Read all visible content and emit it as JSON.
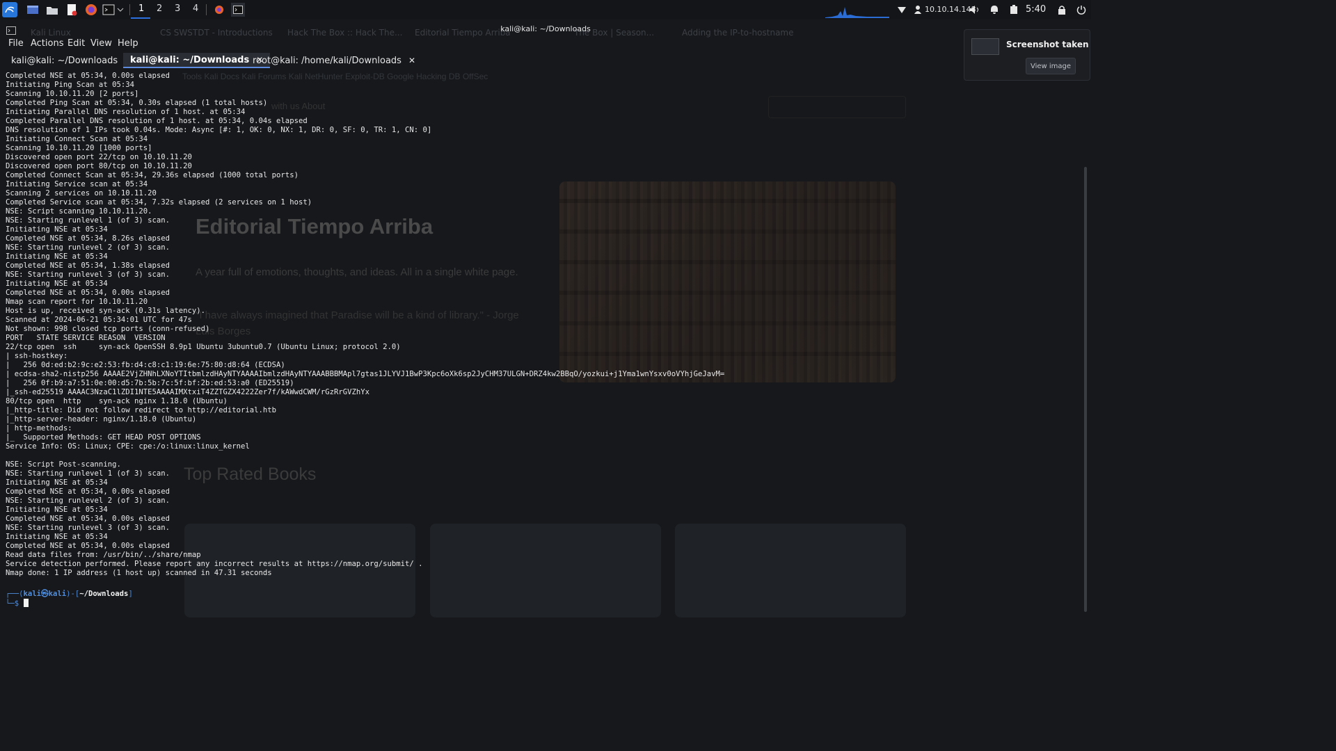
{
  "panel": {
    "workspaces": [
      "1",
      "2",
      "3",
      "4"
    ],
    "active_workspace": "1",
    "ip": "10.10.14.148",
    "time": "5:40"
  },
  "background_browser": {
    "tabs": [
      "Kali Linux",
      "CS SWSTDT - Introductions",
      "Hack The Box :: Hack The...",
      "Editorial Tiempo Arriba",
      "The Box | Season...",
      "Adding the IP-to-hostname"
    ],
    "bookmarks": "Tools  Kali Docs  Kali Forums  Kali NetHunter  Exploit-DB  Google Hacking DB  OffSec",
    "nav": "with us    About",
    "hero_title": "Editorial Tiempo Arriba",
    "hero_subtitle": "A year full of emotions, thoughts, and ideas. All in a single white page.",
    "hero_quote": "\"I have always imagined that Paradise will be a kind of library.\" - Jorge Luis Borges",
    "section_title": "Top Rated Books"
  },
  "terminal": {
    "window_title": "kali@kali: ~/Downloads",
    "menu": [
      "File",
      "Actions",
      "Edit",
      "View",
      "Help"
    ],
    "tabs": [
      {
        "label": "kali@kali: ~/Downloads"
      },
      {
        "label": "kali@kali: ~/Downloads"
      },
      {
        "label": "root@kali: /home/kali/Downloads"
      }
    ],
    "output": "Completed NSE at 05:34, 0.00s elapsed\nInitiating Ping Scan at 05:34\nScanning 10.10.11.20 [2 ports]\nCompleted Ping Scan at 05:34, 0.30s elapsed (1 total hosts)\nInitiating Parallel DNS resolution of 1 host. at 05:34\nCompleted Parallel DNS resolution of 1 host. at 05:34, 0.04s elapsed\nDNS resolution of 1 IPs took 0.04s. Mode: Async [#: 1, OK: 0, NX: 1, DR: 0, SF: 0, TR: 1, CN: 0]\nInitiating Connect Scan at 05:34\nScanning 10.10.11.20 [1000 ports]\nDiscovered open port 22/tcp on 10.10.11.20\nDiscovered open port 80/tcp on 10.10.11.20\nCompleted Connect Scan at 05:34, 29.36s elapsed (1000 total ports)\nInitiating Service scan at 05:34\nScanning 2 services on 10.10.11.20\nCompleted Service scan at 05:34, 7.32s elapsed (2 services on 1 host)\nNSE: Script scanning 10.10.11.20.\nNSE: Starting runlevel 1 (of 3) scan.\nInitiating NSE at 05:34\nCompleted NSE at 05:34, 8.26s elapsed\nNSE: Starting runlevel 2 (of 3) scan.\nInitiating NSE at 05:34\nCompleted NSE at 05:34, 1.38s elapsed\nNSE: Starting runlevel 3 (of 3) scan.\nInitiating NSE at 05:34\nCompleted NSE at 05:34, 0.00s elapsed\nNmap scan report for 10.10.11.20\nHost is up, received syn-ack (0.31s latency).\nScanned at 2024-06-21 05:34:01 UTC for 47s\nNot shown: 998 closed tcp ports (conn-refused)\nPORT   STATE SERVICE REASON  VERSION\n22/tcp open  ssh     syn-ack OpenSSH 8.9p1 Ubuntu 3ubuntu0.7 (Ubuntu Linux; protocol 2.0)\n| ssh-hostkey: \n|   256 0d:ed:b2:9c:e2:53:fb:d4:c8:c1:19:6e:75:80:d8:64 (ECDSA)\n| ecdsa-sha2-nistp256 AAAAE2VjZHNhLXNoYTItbmlzdHAyNTYAAAAIbmlzdHAyNTYAAABBBMApl7gtas1JLYVJ1BwP3Kpc6oXk6sp2JyCHM37ULGN+DRZ4kw2BBqO/yozkui+j1Yma1wnYsxv0oVYhjGeJavM=\n|   256 0f:b9:a7:51:0e:00:d5:7b:5b:7c:5f:bf:2b:ed:53:a0 (ED25519)\n|_ssh-ed25519 AAAAC3NzaC1lZDI1NTE5AAAAIMXtxiT4ZZTGZX4222Zer7f/kAWwdCWM/rGzRrGVZhYx\n80/tcp open  http    syn-ack nginx 1.18.0 (Ubuntu)\n|_http-title: Did not follow redirect to http://editorial.htb\n|_http-server-header: nginx/1.18.0 (Ubuntu)\n| http-methods: \n|_  Supported Methods: GET HEAD POST OPTIONS\nService Info: OS: Linux; CPE: cpe:/o:linux:linux_kernel\n\nNSE: Script Post-scanning.\nNSE: Starting runlevel 1 (of 3) scan.\nInitiating NSE at 05:34\nCompleted NSE at 05:34, 0.00s elapsed\nNSE: Starting runlevel 2 (of 3) scan.\nInitiating NSE at 05:34\nCompleted NSE at 05:34, 0.00s elapsed\nNSE: Starting runlevel 3 (of 3) scan.\nInitiating NSE at 05:34\nCompleted NSE at 05:34, 0.00s elapsed\nRead data files from: /usr/bin/../share/nmap\nService detection performed. Please report any incorrect results at https://nmap.org/submit/ .\nNmap done: 1 IP address (1 host up) scanned in 47.31 seconds",
    "prompt": {
      "line1_prefix": "┌──(",
      "user": "kali㉿kali",
      "mid": ")-[",
      "path": "~/Downloads",
      "suffix": "]",
      "line2": "└─$ "
    }
  },
  "notification": {
    "title": "Screenshot taken",
    "button": "View image"
  }
}
